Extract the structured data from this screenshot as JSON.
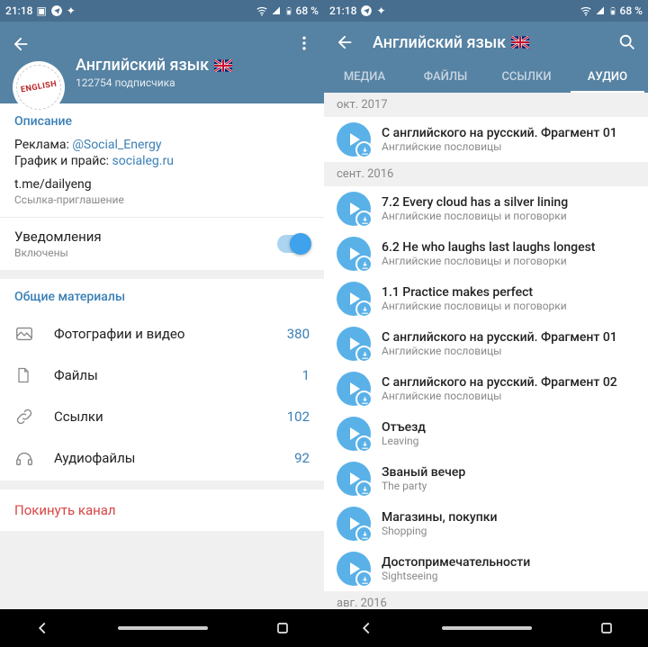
{
  "status": {
    "time": "21:18",
    "battery": "68 %"
  },
  "left": {
    "title": "Английский язык",
    "subscribers": "122754 подписчика",
    "description_title": "Описание",
    "ad_prefix": "Реклама: ",
    "ad_handle": "@Social_Energy",
    "price_prefix": "График и прайс: ",
    "price_link": "socialeg.ru",
    "invite_link": "t.me/dailyeng",
    "invite_sub": "Ссылка-приглашение",
    "notif_label": "Уведомления",
    "notif_status": "Включены",
    "shared_title": "Общие материалы",
    "media": {
      "photos": {
        "label": "Фотографии и видео",
        "count": "380"
      },
      "files": {
        "label": "Файлы",
        "count": "1"
      },
      "links": {
        "label": "Ссылки",
        "count": "102"
      },
      "audio": {
        "label": "Аудиофайлы",
        "count": "92"
      }
    },
    "leave": "Покинуть канал"
  },
  "right": {
    "title": "Английский язык",
    "tabs": {
      "media": "МЕДИА",
      "files": "ФАЙЛЫ",
      "links": "ССЫЛКИ",
      "audio": "АУДИО"
    },
    "groups": [
      {
        "date": "окт. 2017",
        "items": [
          {
            "title": "С английского на русский. Фрагмент 01",
            "sub": "Английские пословицы"
          }
        ]
      },
      {
        "date": "сент. 2016",
        "items": [
          {
            "title": "7.2 Every cloud has a silver lining",
            "sub": "Английские пословицы и поговорки"
          },
          {
            "title": "6.2 He who laughs last laughs longest",
            "sub": "Английские пословицы и поговорки"
          },
          {
            "title": "1.1 Practice makes perfect",
            "sub": "Английские пословицы и поговорки"
          },
          {
            "title": "С английского на русский. Фрагмент 01",
            "sub": "Английские пословицы"
          },
          {
            "title": "С английского на русский. Фрагмент 02",
            "sub": "Английские пословицы"
          },
          {
            "title": "Отъезд",
            "sub": "Leaving"
          },
          {
            "title": "Званый вечер",
            "sub": "The party"
          },
          {
            "title": "Магазины, покупки",
            "sub": "Shopping"
          },
          {
            "title": "Достопримечательности",
            "sub": "Sightseeing"
          }
        ]
      },
      {
        "date": "авг. 2016",
        "items": []
      }
    ]
  }
}
